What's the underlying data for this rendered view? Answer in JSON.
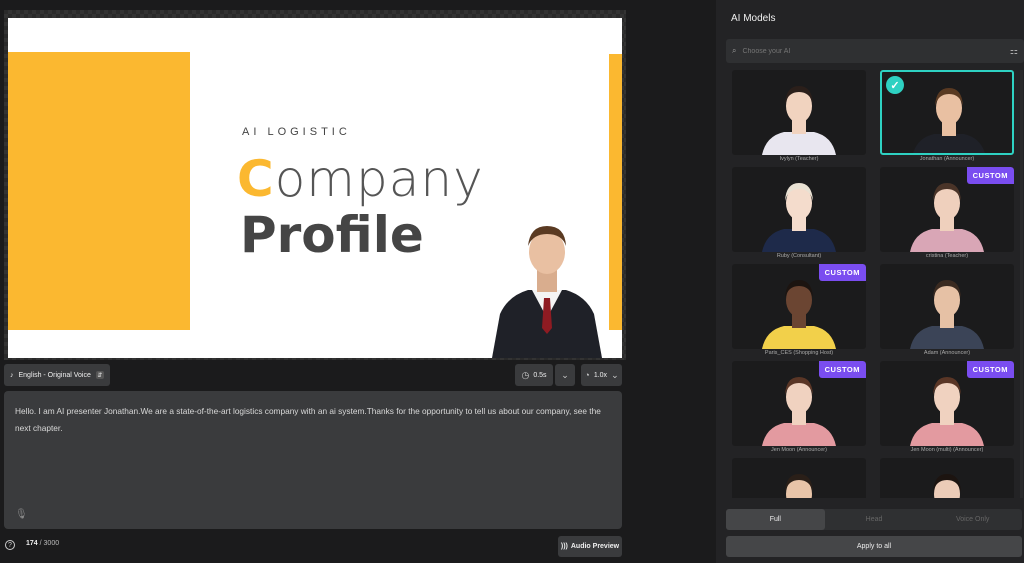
{
  "editor": {
    "slide": {
      "subtitle": "AI LOGISTIC",
      "title_first_letter": "C",
      "title_rest": "ompany",
      "title_line2": "Profile"
    },
    "language_label": "English - Original Voice",
    "pause_value": "0.5s",
    "speed_value": "1.0x",
    "script_text": "Hello. I am AI presenter Jonathan.We are a state-of-the-art logistics company with an ai system.Thanks for the opportunity to tell us about our company, see the next chapter.",
    "char_count": "174",
    "char_limit": "/ 3000",
    "audio_preview_label": "Audio Preview"
  },
  "panel": {
    "title": "AI Models",
    "search_placeholder": "Choose your AI",
    "models": [
      {
        "name": "Ivylyn (Teacher)",
        "custom": false,
        "selected": false,
        "hair": "#2b1f1a",
        "skin": "#f1d3bf",
        "outfit": "#e8e6ef"
      },
      {
        "name": "Jonathan (Announcer)",
        "custom": false,
        "selected": true,
        "hair": "#5a3a22",
        "skin": "#e9c0a2",
        "outfit": "#1f2128"
      },
      {
        "name": "Ruby (Consultant)",
        "custom": false,
        "selected": false,
        "hair": "#e9e1d3",
        "skin": "#f4dccc",
        "outfit": "#1e2a4a"
      },
      {
        "name": "cristina (Teacher)",
        "custom": true,
        "selected": false,
        "hair": "#4a3428",
        "skin": "#efd0bd",
        "outfit": "#d9a6b6"
      },
      {
        "name": "Paris_CES (Shopping Host)",
        "custom": true,
        "selected": false,
        "hair": "#1c1410",
        "skin": "#6b4532",
        "outfit": "#f2d04a"
      },
      {
        "name": "Adam (Announcer)",
        "custom": false,
        "selected": false,
        "hair": "#3a2a20",
        "skin": "#e6c1a5",
        "outfit": "#3b4457"
      },
      {
        "name": "Jen Moon (Announcer)",
        "custom": true,
        "selected": false,
        "hair": "#5a3626",
        "skin": "#f0d2c0",
        "outfit": "#e39aa0"
      },
      {
        "name": "Jen Moon (multi) (Announcer)",
        "custom": true,
        "selected": false,
        "hair": "#5a3626",
        "skin": "#f0d2c0",
        "outfit": "#e39aa0"
      },
      {
        "name": "",
        "custom": false,
        "selected": false,
        "hair": "#2a1f18",
        "skin": "#e8c4a8",
        "outfit": "#222"
      },
      {
        "name": "",
        "custom": false,
        "selected": false,
        "hair": "#1c1410",
        "skin": "#ecccb8",
        "outfit": "#222"
      }
    ],
    "custom_badge_label": "CUSTOM",
    "modes": [
      "Full",
      "Head",
      "Voice Only"
    ],
    "active_mode": "Full",
    "apply_label": "Apply to all"
  },
  "colors": {
    "accent_teal": "#2ed1c2",
    "custom_purple": "#7a4df0",
    "slide_yellow": "#fbb830"
  }
}
